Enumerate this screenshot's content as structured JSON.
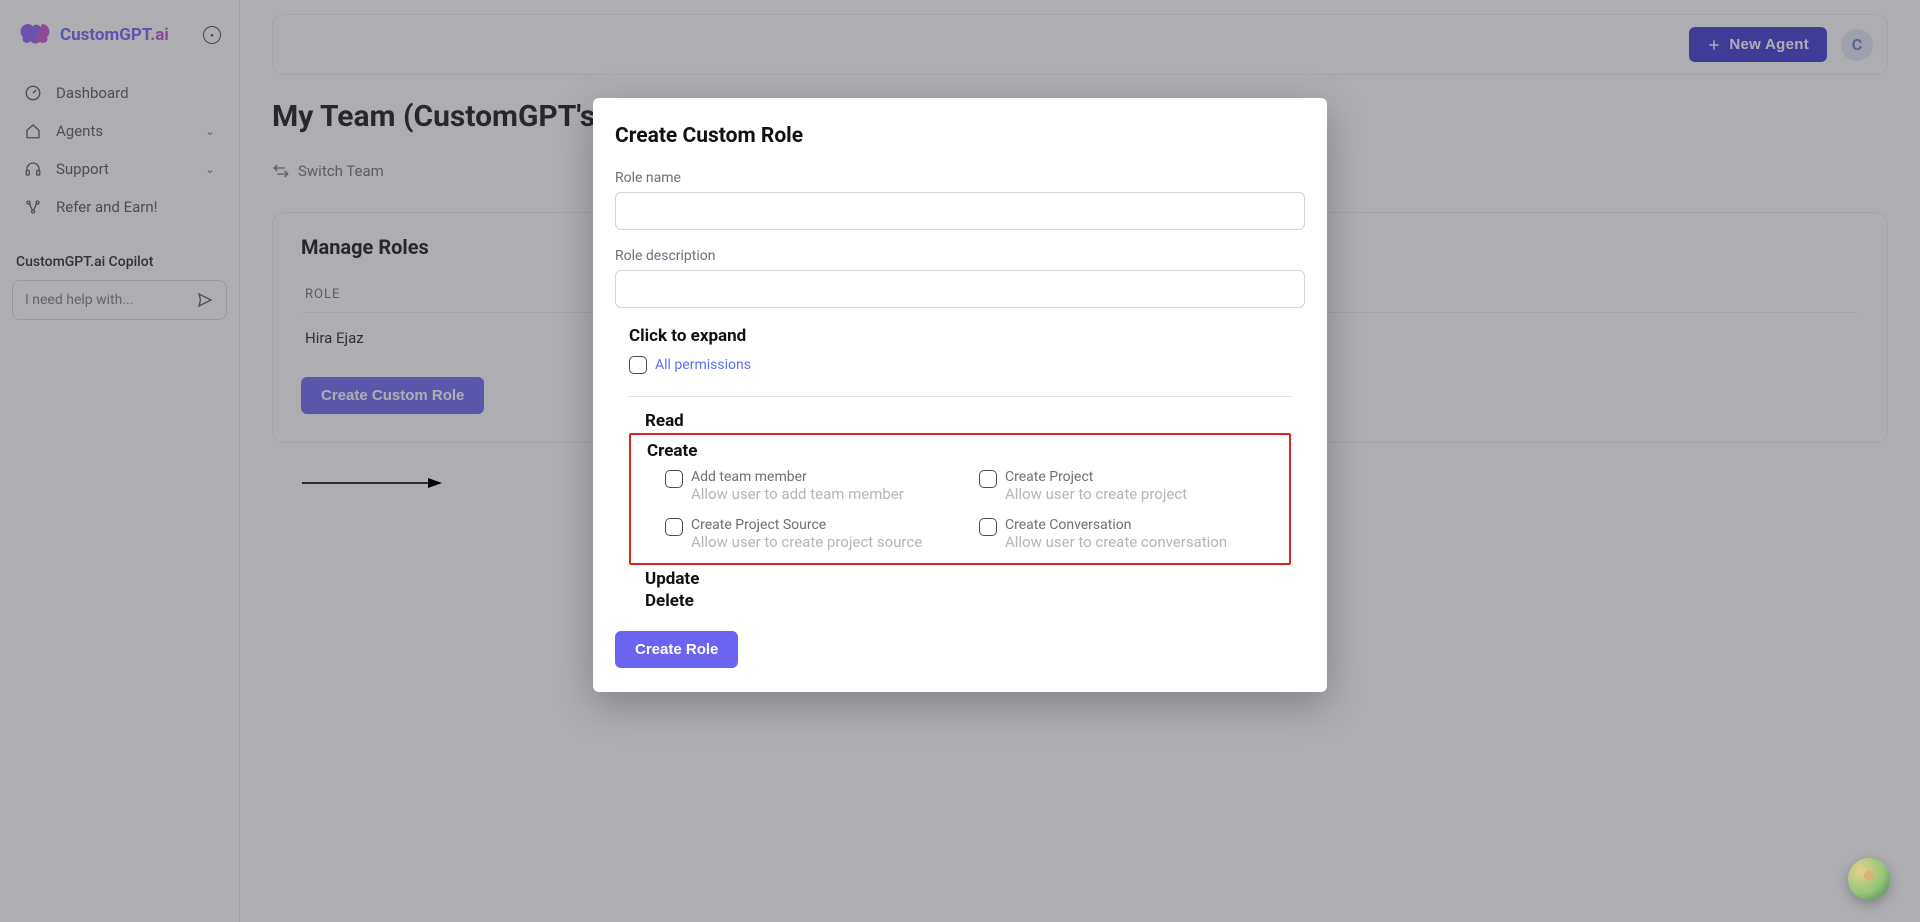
{
  "brand": {
    "part1": "CustomGPT",
    "part2": ".ai"
  },
  "sidebar": {
    "items": [
      {
        "label": "Dashboard"
      },
      {
        "label": "Agents"
      },
      {
        "label": "Support"
      },
      {
        "label": "Refer and Earn!"
      }
    ],
    "copilot_label": "CustomGPT.ai Copilot",
    "copilot_placeholder": "I need help with..."
  },
  "header": {
    "new_agent": "New Agent",
    "avatar_initial": "C"
  },
  "page": {
    "title": "My Team (CustomGPT's Team)",
    "tab_switch": "Switch Team",
    "panel_title": "Manage Roles",
    "col_role": "ROLE",
    "row_name": "Hira Ejaz",
    "create_custom_btn": "Create Custom Role"
  },
  "modal": {
    "title": "Create Custom Role",
    "role_name_label": "Role name",
    "role_desc_label": "Role description",
    "click_expand": "Click to expand",
    "all_permissions": "All permissions",
    "cat_read": "Read",
    "cat_create": "Create",
    "cat_update": "Update",
    "cat_delete": "Delete",
    "perms": {
      "add_team": {
        "title": "Add team member",
        "desc": "Allow user to add team member"
      },
      "create_project": {
        "title": "Create Project",
        "desc": "Allow user to create project"
      },
      "create_source": {
        "title": "Create Project Source",
        "desc": "Allow user to create project source"
      },
      "create_conv": {
        "title": "Create Conversation",
        "desc": "Allow user to create conversation"
      }
    },
    "create_role_btn": "Create Role"
  }
}
